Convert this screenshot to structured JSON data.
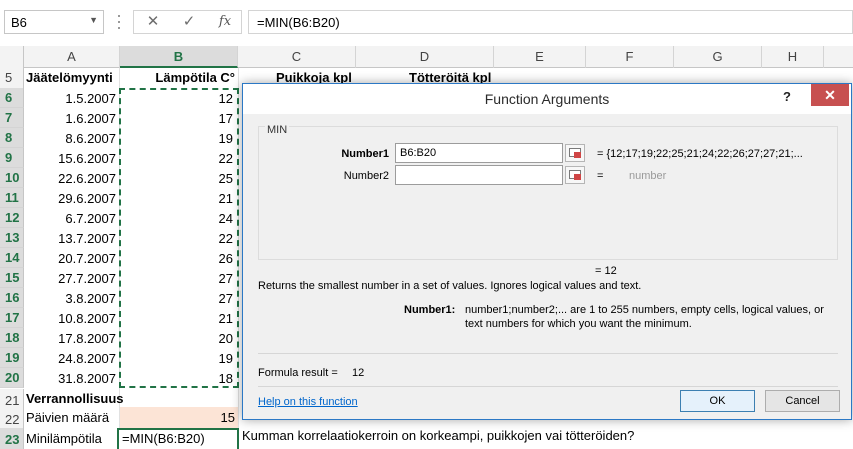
{
  "formula_bar": {
    "name_box": "B6",
    "formula": "=MIN(B6:B20)"
  },
  "columns": [
    "A",
    "B",
    "C",
    "D",
    "E",
    "F",
    "G",
    "H"
  ],
  "rows": {
    "r5": {
      "num": "5",
      "a": "Jäätelömyynti",
      "b": "Lämpötila C°",
      "c": "Puikkoja kpl",
      "d": "Tötteröitä kpl"
    },
    "r6": {
      "num": "6",
      "a": "1.5.2007",
      "b": "12"
    },
    "r7": {
      "num": "7",
      "a": "1.6.2007",
      "b": "17"
    },
    "r8": {
      "num": "8",
      "a": "8.6.2007",
      "b": "19"
    },
    "r9": {
      "num": "9",
      "a": "15.6.2007",
      "b": "22"
    },
    "r10": {
      "num": "10",
      "a": "22.6.2007",
      "b": "25"
    },
    "r11": {
      "num": "11",
      "a": "29.6.2007",
      "b": "21"
    },
    "r12": {
      "num": "12",
      "a": "6.7.2007",
      "b": "24"
    },
    "r13": {
      "num": "13",
      "a": "13.7.2007",
      "b": "22"
    },
    "r14": {
      "num": "14",
      "a": "20.7.2007",
      "b": "26"
    },
    "r15": {
      "num": "15",
      "a": "27.7.2007",
      "b": "27"
    },
    "r16": {
      "num": "16",
      "a": "3.8.2007",
      "b": "27"
    },
    "r17": {
      "num": "17",
      "a": "10.8.2007",
      "b": "21"
    },
    "r18": {
      "num": "18",
      "a": "17.8.2007",
      "b": "20"
    },
    "r19": {
      "num": "19",
      "a": "24.8.2007",
      "b": "19"
    },
    "r20": {
      "num": "20",
      "a": "31.8.2007",
      "b": "18"
    },
    "r21": {
      "num": "21",
      "a": "Verrannollisuus"
    },
    "r22": {
      "num": "22",
      "a": "Päivien määrä",
      "b": "15"
    },
    "r23": {
      "num": "23",
      "a": "Minilämpötila",
      "b": "=MIN(B6:B20)",
      "c": "Kumman korrelaatiokerroin on korkeampi, puikkojen vai tötteröiden?"
    }
  },
  "dialog": {
    "title": "Function Arguments",
    "help_glyph": "?",
    "close_glyph": "✕",
    "function_name": "MIN",
    "arg1_label": "Number1",
    "arg1_value": "B6:B20",
    "arg1_result": "=   {12;17;19;22;25;21;24;22;26;27;27;21;...",
    "arg2_label": "Number2",
    "arg2_value": "",
    "arg2_result_eq": "=",
    "arg2_result": "number",
    "total_result": "=   12",
    "description": "Returns the smallest number in a set of values. Ignores logical values and text.",
    "arg_help_label": "Number1:",
    "arg_help_line1": "number1;number2;... are 1 to 255 numbers, empty cells, logical values, or",
    "arg_help_line2": "text numbers for which you want the minimum.",
    "formula_result_label": "Formula result =",
    "formula_result_value": "12",
    "help_link": "Help on this function",
    "ok_label": "OK",
    "cancel_label": "Cancel"
  },
  "colors": {
    "accent": "#217346",
    "dialog_border": "#2b78c5",
    "close_button": "#c75050",
    "link": "#0066cc",
    "highlight_row22": "#fce4d6"
  },
  "icons": {
    "cancel": "close-icon",
    "enter": "check-icon",
    "function": "fx-icon"
  }
}
